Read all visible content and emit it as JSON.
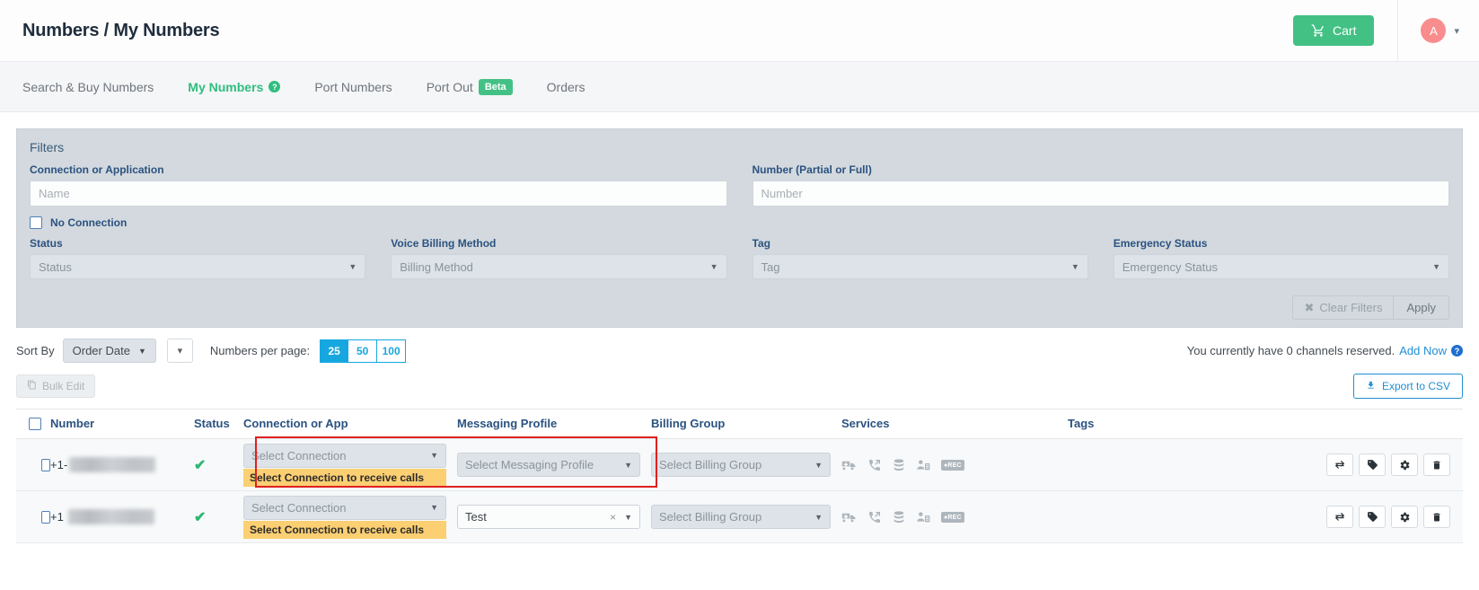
{
  "header": {
    "breadcrumb": "Numbers / My Numbers",
    "cart_label": "Cart",
    "cart_icon": "shopping-cart-icon",
    "avatar_initial": "A",
    "avatar_color": "#f98d8d",
    "accent_green": "#43c185"
  },
  "nav": {
    "tabs": [
      {
        "label": "Search & Buy Numbers",
        "active": false
      },
      {
        "label": "My Numbers",
        "active": true,
        "help": "?"
      },
      {
        "label": "Port Numbers",
        "active": false
      },
      {
        "label": "Port Out",
        "active": false,
        "badge": "Beta"
      },
      {
        "label": "Orders",
        "active": false
      }
    ]
  },
  "filters": {
    "title": "Filters",
    "connection_label": "Connection or Application",
    "connection_placeholder": "Name",
    "connection_value": "",
    "number_label": "Number (Partial or Full)",
    "number_placeholder": "Number",
    "number_value": "",
    "no_connection_label": "No Connection",
    "no_connection_checked": false,
    "status_label": "Status",
    "status_value": "Status",
    "voice_billing_label": "Voice Billing Method",
    "voice_billing_value": "Billing Method",
    "tag_label": "Tag",
    "tag_value": "Tag",
    "emergency_label": "Emergency Status",
    "emergency_value": "Emergency Status",
    "clear_label": "Clear Filters",
    "apply_label": "Apply"
  },
  "toolbar": {
    "sort_by_label": "Sort By",
    "sort_by_value": "Order Date",
    "sort_dir_icon": "chevron-down-icon",
    "per_page_label": "Numbers per page:",
    "per_page_options": [
      "25",
      "50",
      "100"
    ],
    "per_page_selected": "25",
    "channels_text": "You currently have 0 channels reserved.",
    "channels_link": "Add Now",
    "bulk_edit_label": "Bulk Edit",
    "export_label": "Export to CSV"
  },
  "table": {
    "columns": [
      "Number",
      "Status",
      "Connection or App",
      "Messaging Profile",
      "Billing Group",
      "Services",
      "Tags"
    ],
    "rows": [
      {
        "number_prefix": "+1-",
        "number_masked": true,
        "status_icon": "check-icon",
        "connection_value": "Select Connection",
        "connection_warning": "Select Connection to receive calls",
        "messaging_value": "Select Messaging Profile",
        "messaging_filled": false,
        "billing_value": "Select Billing Group",
        "services": [
          "ambulance-icon",
          "call-forward-icon",
          "database-icon",
          "caller-id-icon",
          "rec-icon"
        ],
        "tags": "",
        "actions": [
          "transfer-icon",
          "tag-icon",
          "gear-icon",
          "trash-icon"
        ],
        "highlighted": true
      },
      {
        "number_prefix": "+1",
        "number_masked": true,
        "status_icon": "check-icon",
        "connection_value": "Select Connection",
        "connection_warning": "Select Connection to receive calls",
        "messaging_value": "Test",
        "messaging_filled": true,
        "messaging_clear": "×",
        "billing_value": "Select Billing Group",
        "services": [
          "ambulance-icon",
          "call-forward-icon",
          "database-icon",
          "caller-id-icon",
          "rec-icon"
        ],
        "tags": "",
        "actions": [
          "transfer-icon",
          "tag-icon",
          "gear-icon",
          "trash-icon"
        ],
        "highlighted": false
      }
    ]
  }
}
